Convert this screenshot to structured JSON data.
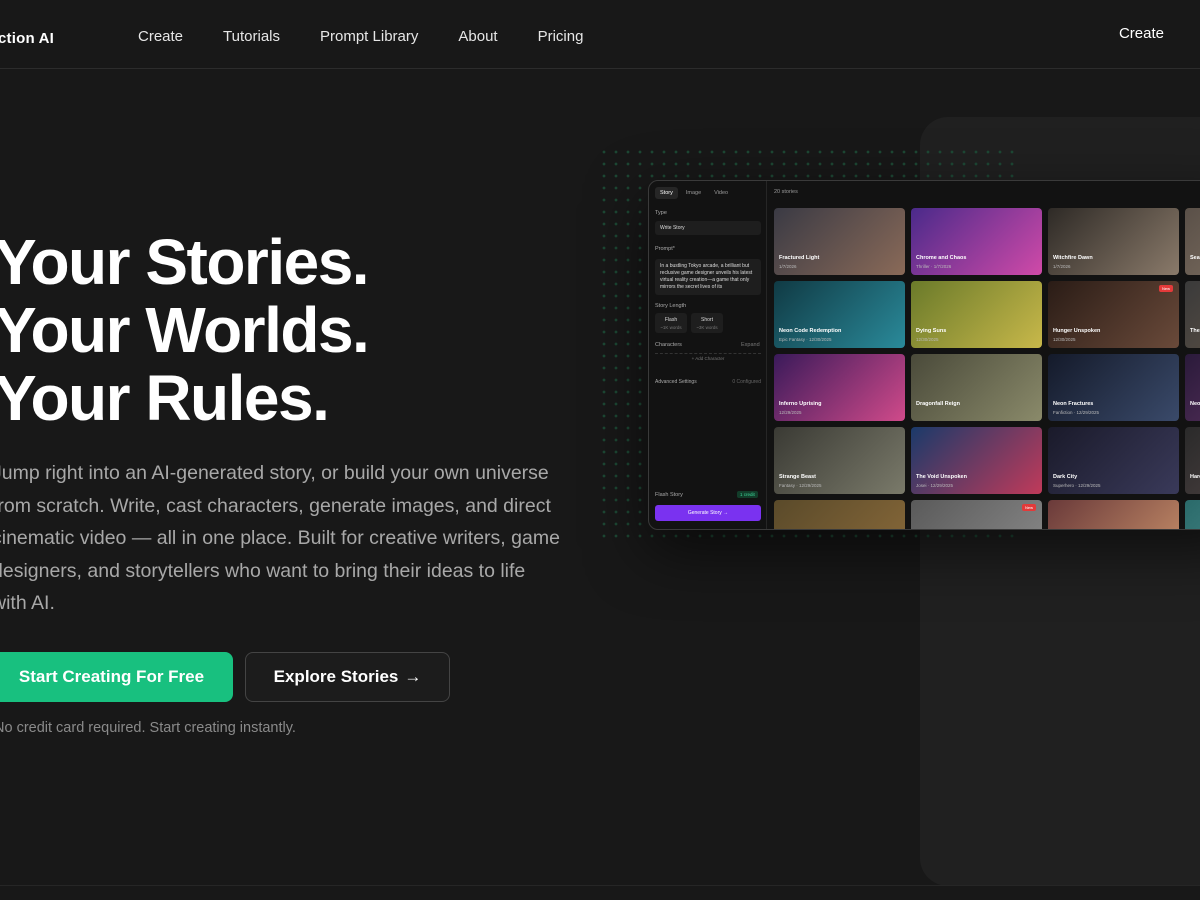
{
  "nav": {
    "logo": "ction AI",
    "links": [
      "Create",
      "Tutorials",
      "Prompt Library",
      "About",
      "Pricing"
    ],
    "cta": "Create"
  },
  "hero": {
    "headline": [
      "Your Stories.",
      "Your Worlds.",
      "Your Rules."
    ],
    "subtext": "Jump right into an AI-generated story, or build your own universe from scratch. Write, cast characters, generate images, and direct cinematic video — all in one place. Built for creative writers, game designers, and storytellers who want to bring their ideas to life with AI.",
    "primary_button": "Start Creating For Free",
    "secondary_button": "Explore Stories",
    "secondary_arrow": "→",
    "note": "No credit card required. Start creating instantly."
  },
  "preview": {
    "tabs": [
      "Story",
      "Image",
      "Video"
    ],
    "story_count": "20 stories",
    "type_label": "Type",
    "type_value": "Write Story",
    "prompt_label": "Prompt*",
    "prompt_text": "In a bustling Tokyo arcade, a brilliant but reclusive game designer unveils his latest virtual reality creation—a game that only mirrors the secret lives of its",
    "length_label": "Story Length",
    "length_options": [
      {
        "name": "Flash",
        "sub": "~1K words"
      },
      {
        "name": "Short",
        "sub": "~3K words"
      }
    ],
    "characters_label": "Characters",
    "characters_action": "Expand",
    "add_character": "+ Add Character",
    "advanced_label": "Advanced Settings",
    "advanced_value": "0 Configured",
    "footer_label": "Flash Story",
    "credit": "1 credit",
    "generate": "Generate Story →",
    "tiles": [
      {
        "title": "Fractured Light",
        "meta": "1/7/2026",
        "colors": [
          "#3a3a44",
          "#8a6a58"
        ]
      },
      {
        "title": "Chrome and Chaos",
        "meta": "Thriller · 1/7/2026",
        "colors": [
          "#4a2a8a",
          "#d04aa8"
        ]
      },
      {
        "title": "Witchfire Dawn",
        "meta": "1/7/2026",
        "colors": [
          "#2e2a26",
          "#8a7a6a"
        ]
      },
      {
        "title": "Season",
        "meta": "",
        "colors": [
          "#5a5048",
          "#8a7a6a"
        ]
      },
      {
        "title": "Neon Code Redemption",
        "meta": "Epic Fantasy · 12/30/2025",
        "colors": [
          "#103a44",
          "#2a8a9a"
        ]
      },
      {
        "title": "Dying Suns",
        "meta": "12/30/2025",
        "colors": [
          "#6a7a2a",
          "#c8b84a"
        ]
      },
      {
        "title": "Hunger Unspoken",
        "meta": "12/30/2025",
        "colors": [
          "#2a1c16",
          "#6a4a3a"
        ],
        "badge": "New"
      },
      {
        "title": "The C",
        "meta": "",
        "colors": [
          "#3a3a3a",
          "#6a5a4a"
        ]
      },
      {
        "title": "Inferno Uprising",
        "meta": "12/29/2025",
        "colors": [
          "#3a1a5a",
          "#d04a8a"
        ]
      },
      {
        "title": "Dragonfall Reign",
        "meta": "",
        "colors": [
          "#4a4a3a",
          "#8a8a6a"
        ]
      },
      {
        "title": "Neon Fractures",
        "meta": "Fanfiction · 12/29/2025",
        "colors": [
          "#141a2a",
          "#3a4a6a"
        ]
      },
      {
        "title": "Neon",
        "meta": "",
        "colors": [
          "#2a1a3a",
          "#6a3a6a"
        ]
      },
      {
        "title": "Strange Beast",
        "meta": "Fantasy · 12/29/2025",
        "colors": [
          "#3a3a34",
          "#7a7a6a"
        ]
      },
      {
        "title": "The Void Unspoken",
        "meta": "Josei · 12/29/2025",
        "colors": [
          "#1a3a6a",
          "#c03a5a"
        ]
      },
      {
        "title": "Dark City",
        "meta": "Superhero · 12/29/2025",
        "colors": [
          "#1a1a2a",
          "#3a3a5a"
        ]
      },
      {
        "title": "Hardt",
        "meta": "",
        "colors": [
          "#2a2a2a",
          "#5a4a4a"
        ]
      },
      {
        "title": "",
        "meta": "",
        "colors": [
          "#5a4a2a",
          "#8a6a3a"
        ]
      },
      {
        "title": "",
        "meta": "",
        "colors": [
          "#5a5a5a",
          "#8a8a8a"
        ],
        "badge": "New"
      },
      {
        "title": "",
        "meta": "",
        "colors": [
          "#6a3a3a",
          "#c8906a"
        ]
      },
      {
        "title": "",
        "meta": "",
        "colors": [
          "#2a6a6a",
          "#5a9a9a"
        ]
      }
    ]
  }
}
